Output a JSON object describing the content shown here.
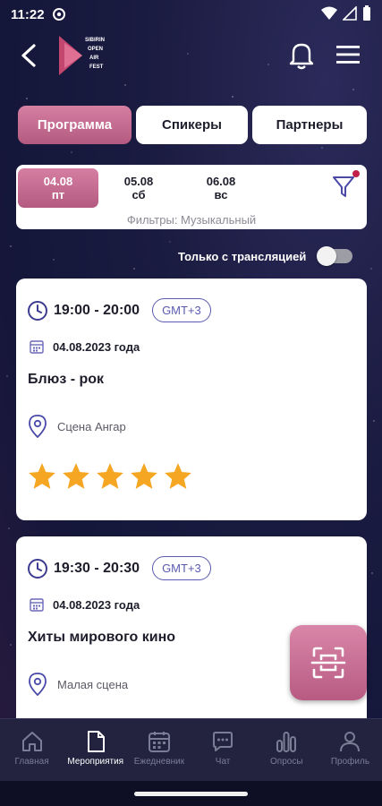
{
  "status_bar": {
    "time": "11:22"
  },
  "header": {
    "logo_text": [
      "SIBIRIN",
      "OPEN",
      "AIR",
      "FEST"
    ]
  },
  "tabs": [
    {
      "label": "Программа",
      "active": true
    },
    {
      "label": "Спикеры",
      "active": false
    },
    {
      "label": "Партнеры",
      "active": false
    }
  ],
  "dates": [
    {
      "date": "04.08",
      "weekday": "пт",
      "active": true
    },
    {
      "date": "05.08",
      "weekday": "сб",
      "active": false
    },
    {
      "date": "06.08",
      "weekday": "вс",
      "active": false
    }
  ],
  "filters_text": "Фильтры: Музыкальный",
  "stream_toggle": {
    "label": "Только с трансляцией",
    "on": false
  },
  "events": [
    {
      "time": "19:00 - 20:00",
      "timezone": "GMT+3",
      "date": "04.08.2023 года",
      "title": "Блюз - рок",
      "venue": "Сцена Ангар",
      "rating": 5
    },
    {
      "time": "19:30 - 20:30",
      "timezone": "GMT+3",
      "date": "04.08.2023 года",
      "title": "Хиты мирового кино",
      "venue": "Малая сцена"
    }
  ],
  "bottom_nav": [
    {
      "label": "Главная",
      "icon": "home-icon",
      "active": false
    },
    {
      "label": "Мероприятия",
      "icon": "document-icon",
      "active": true
    },
    {
      "label": "Ежедневник",
      "icon": "calendar-icon",
      "active": false
    },
    {
      "label": "Чат",
      "icon": "chat-icon",
      "active": false
    },
    {
      "label": "Опросы",
      "icon": "bar-chart-icon",
      "active": false
    },
    {
      "label": "Профиль",
      "icon": "profile-icon",
      "active": false
    }
  ],
  "colors": {
    "accent": "#c96b93",
    "star": "#f5a623",
    "badge": "#5b5ab0",
    "background": "#1a1b40"
  }
}
